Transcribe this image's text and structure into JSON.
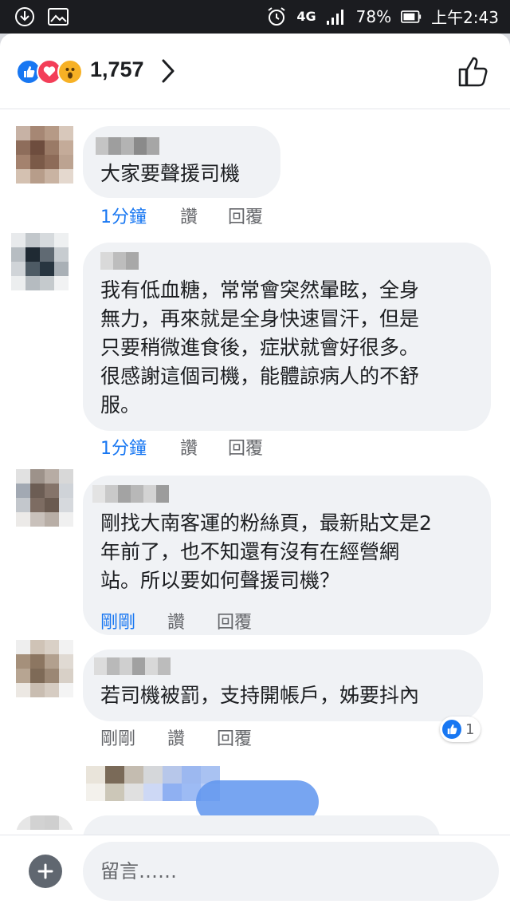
{
  "status_bar": {
    "battery": "78%",
    "network": "4G",
    "time": "上午2:43"
  },
  "reactions": {
    "count": "1,757",
    "types": [
      "like",
      "love",
      "wow"
    ]
  },
  "comments": [
    {
      "text": "大家要聲援司機",
      "time": "1分鐘",
      "like": "讚",
      "reply": "回覆"
    },
    {
      "text": "我有低血糖，常常會突然暈眩，全身\n無力，再來就是全身快速冒汗，但是\n只要稍微進食後，症狀就會好很多。\n很感謝這個司機，能體諒病人的不舒\n服。",
      "time": "1分鐘",
      "like": "讚",
      "reply": "回覆"
    },
    {
      "text": "剛找大南客運的粉絲頁，最新貼文是2\n年前了，也不知還有沒有在經營網\n站。所以要如何聲援司機？",
      "time": "剛剛",
      "like": "讚",
      "reply": "回覆"
    },
    {
      "text": "若司機被罰，支持開帳戶，姊要抖內",
      "time": "剛剛",
      "like": "讚",
      "reply": "回覆",
      "reaction_count": "1"
    }
  ],
  "composer": {
    "placeholder": "留言……"
  },
  "colors": {
    "accent": "#1877f2",
    "bubble": "#f0f2f5",
    "muted": "#65676b"
  },
  "icons": [
    "download-icon",
    "image-icon",
    "alarm-icon",
    "signal-icon",
    "battery-icon",
    "chevron-right-icon",
    "thumbs-up-icon",
    "plus-icon"
  ]
}
